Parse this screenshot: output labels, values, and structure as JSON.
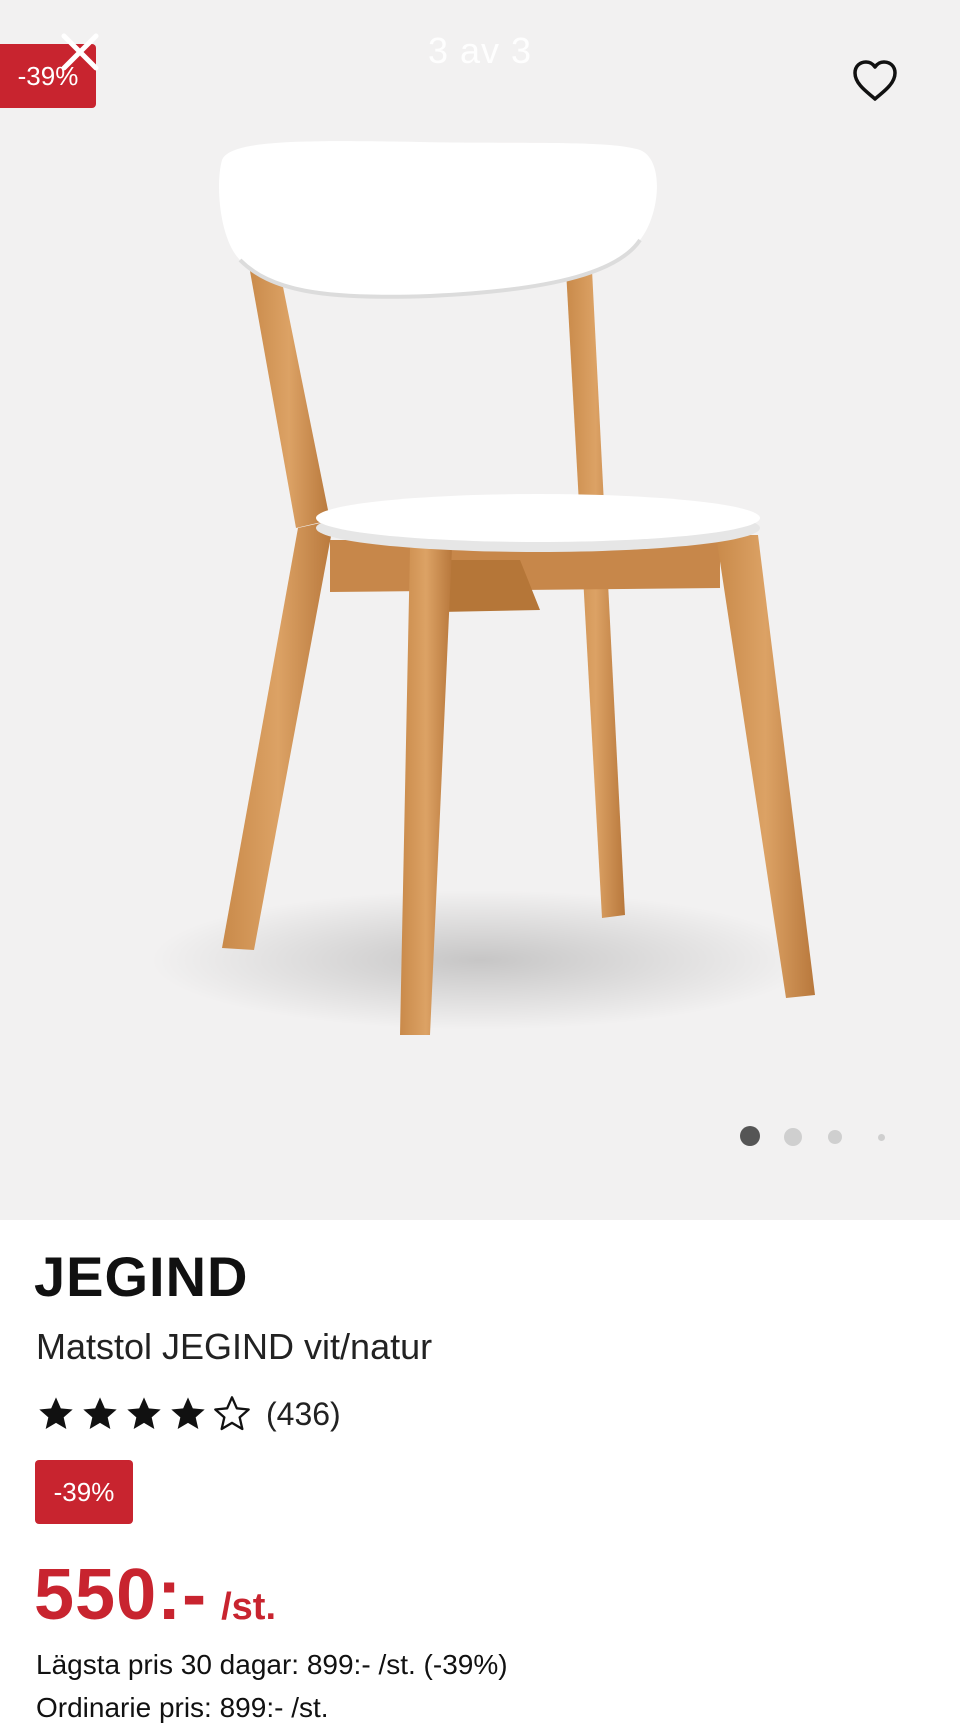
{
  "gallery": {
    "discount_badge": "-39%",
    "counter": "3 av 3",
    "close_icon": "close-icon",
    "favorite_icon": "heart-icon",
    "dots": 4,
    "active_dot": 0
  },
  "product": {
    "brand": "JEGIND",
    "name": "Matstol JEGIND vit/natur",
    "rating": 4,
    "rating_max": 5,
    "review_count": "(436)",
    "discount_badge": "-39%",
    "price": "550:-",
    "unit": "/st.",
    "lowest_price_line": "Lägsta pris 30 dagar: 899:- /st. (-39%)",
    "regular_price_line": "Ordinarie pris: 899:- /st."
  },
  "colors": {
    "accent": "#c8242f",
    "hero_bg": "#f2f1f1"
  }
}
